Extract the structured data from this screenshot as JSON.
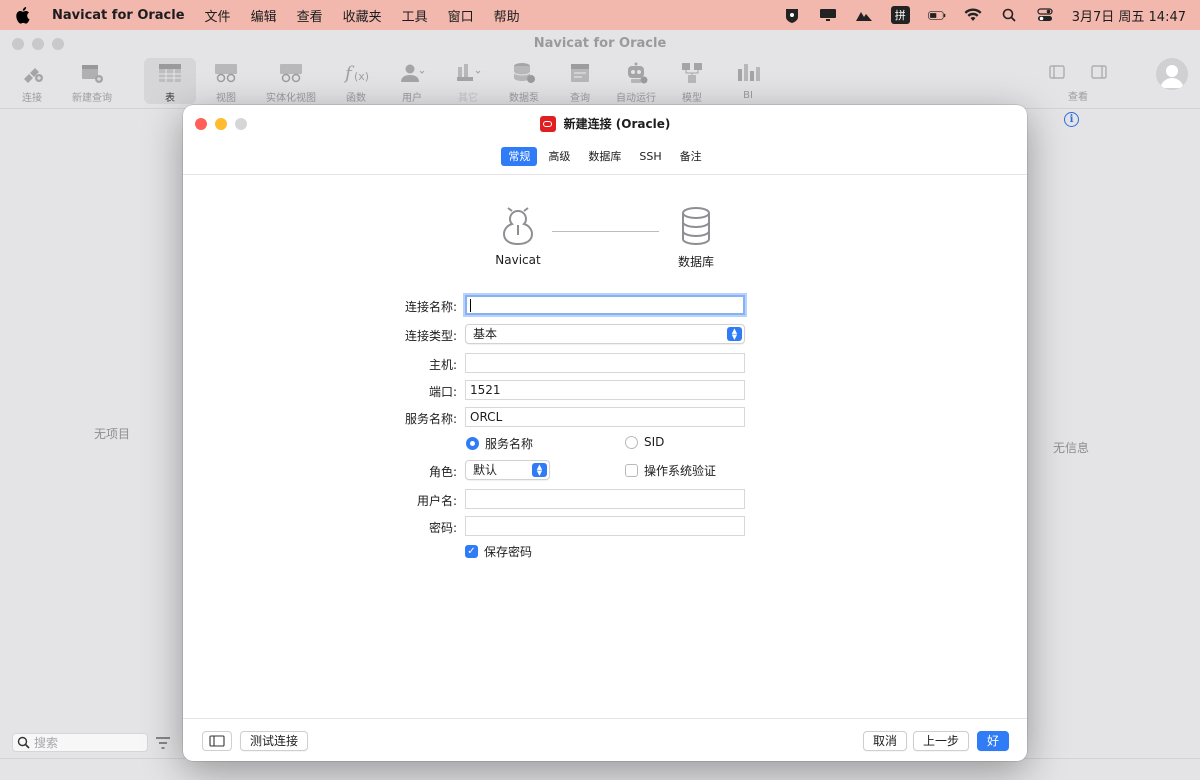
{
  "menubar": {
    "app_name": "Navicat for Oracle",
    "items": [
      "文件",
      "编辑",
      "查看",
      "收藏夹",
      "工具",
      "窗口",
      "帮助"
    ],
    "input_method": "拼",
    "datetime": "3月7日 周五  14:47"
  },
  "window": {
    "title": "Navicat for Oracle"
  },
  "toolbar": {
    "tools": [
      {
        "label": "连接",
        "icon": "plug-icon"
      },
      {
        "label": "新建查询",
        "icon": "new-query-icon"
      },
      {
        "label": "表",
        "icon": "table-icon"
      },
      {
        "label": "视图",
        "icon": "view-icon"
      },
      {
        "label": "实体化视图",
        "icon": "materialized-view-icon"
      },
      {
        "label": "函数",
        "icon": "function-icon"
      },
      {
        "label": "用户",
        "icon": "user-icon"
      },
      {
        "label": "其它",
        "icon": "other-icon"
      },
      {
        "label": "数据泵",
        "icon": "data-pump-icon"
      },
      {
        "label": "查询",
        "icon": "query-icon"
      },
      {
        "label": "自动运行",
        "icon": "robot-icon"
      },
      {
        "label": "模型",
        "icon": "model-icon"
      },
      {
        "label": "BI",
        "icon": "bi-icon"
      }
    ],
    "view_label": "查看"
  },
  "sidebar": {
    "empty_text": "无项目",
    "search_placeholder": "搜索"
  },
  "info_panel": {
    "empty_text": "无信息"
  },
  "dialog": {
    "title": "新建连接 (Oracle)",
    "tabs": [
      "常规",
      "高级",
      "数据库",
      "SSH",
      "备注"
    ],
    "active_tab": "常规",
    "diagram": {
      "left_label": "Navicat",
      "right_label": "数据库"
    },
    "form": {
      "connection_name_label": "连接名称:",
      "connection_name_value": "",
      "connection_type_label": "连接类型:",
      "connection_type_value": "基本",
      "host_label": "主机:",
      "host_value": "",
      "port_label": "端口:",
      "port_value": "1521",
      "service_name_label": "服务名称:",
      "service_name_value": "ORCL",
      "radio_service_name": "服务名称",
      "radio_sid": "SID",
      "role_label": "角色:",
      "role_value": "默认",
      "os_auth_label": "操作系统验证",
      "username_label": "用户名:",
      "username_value": "",
      "password_label": "密码:",
      "password_value": "",
      "save_password_label": "保存密码"
    },
    "footer": {
      "test_connection": "测试连接",
      "cancel": "取消",
      "previous": "上一步",
      "ok": "好"
    }
  },
  "colors": {
    "accent": "#2f7cf6",
    "menubar_bg": "#f3b8ad",
    "oracle_red": "#e02020"
  }
}
